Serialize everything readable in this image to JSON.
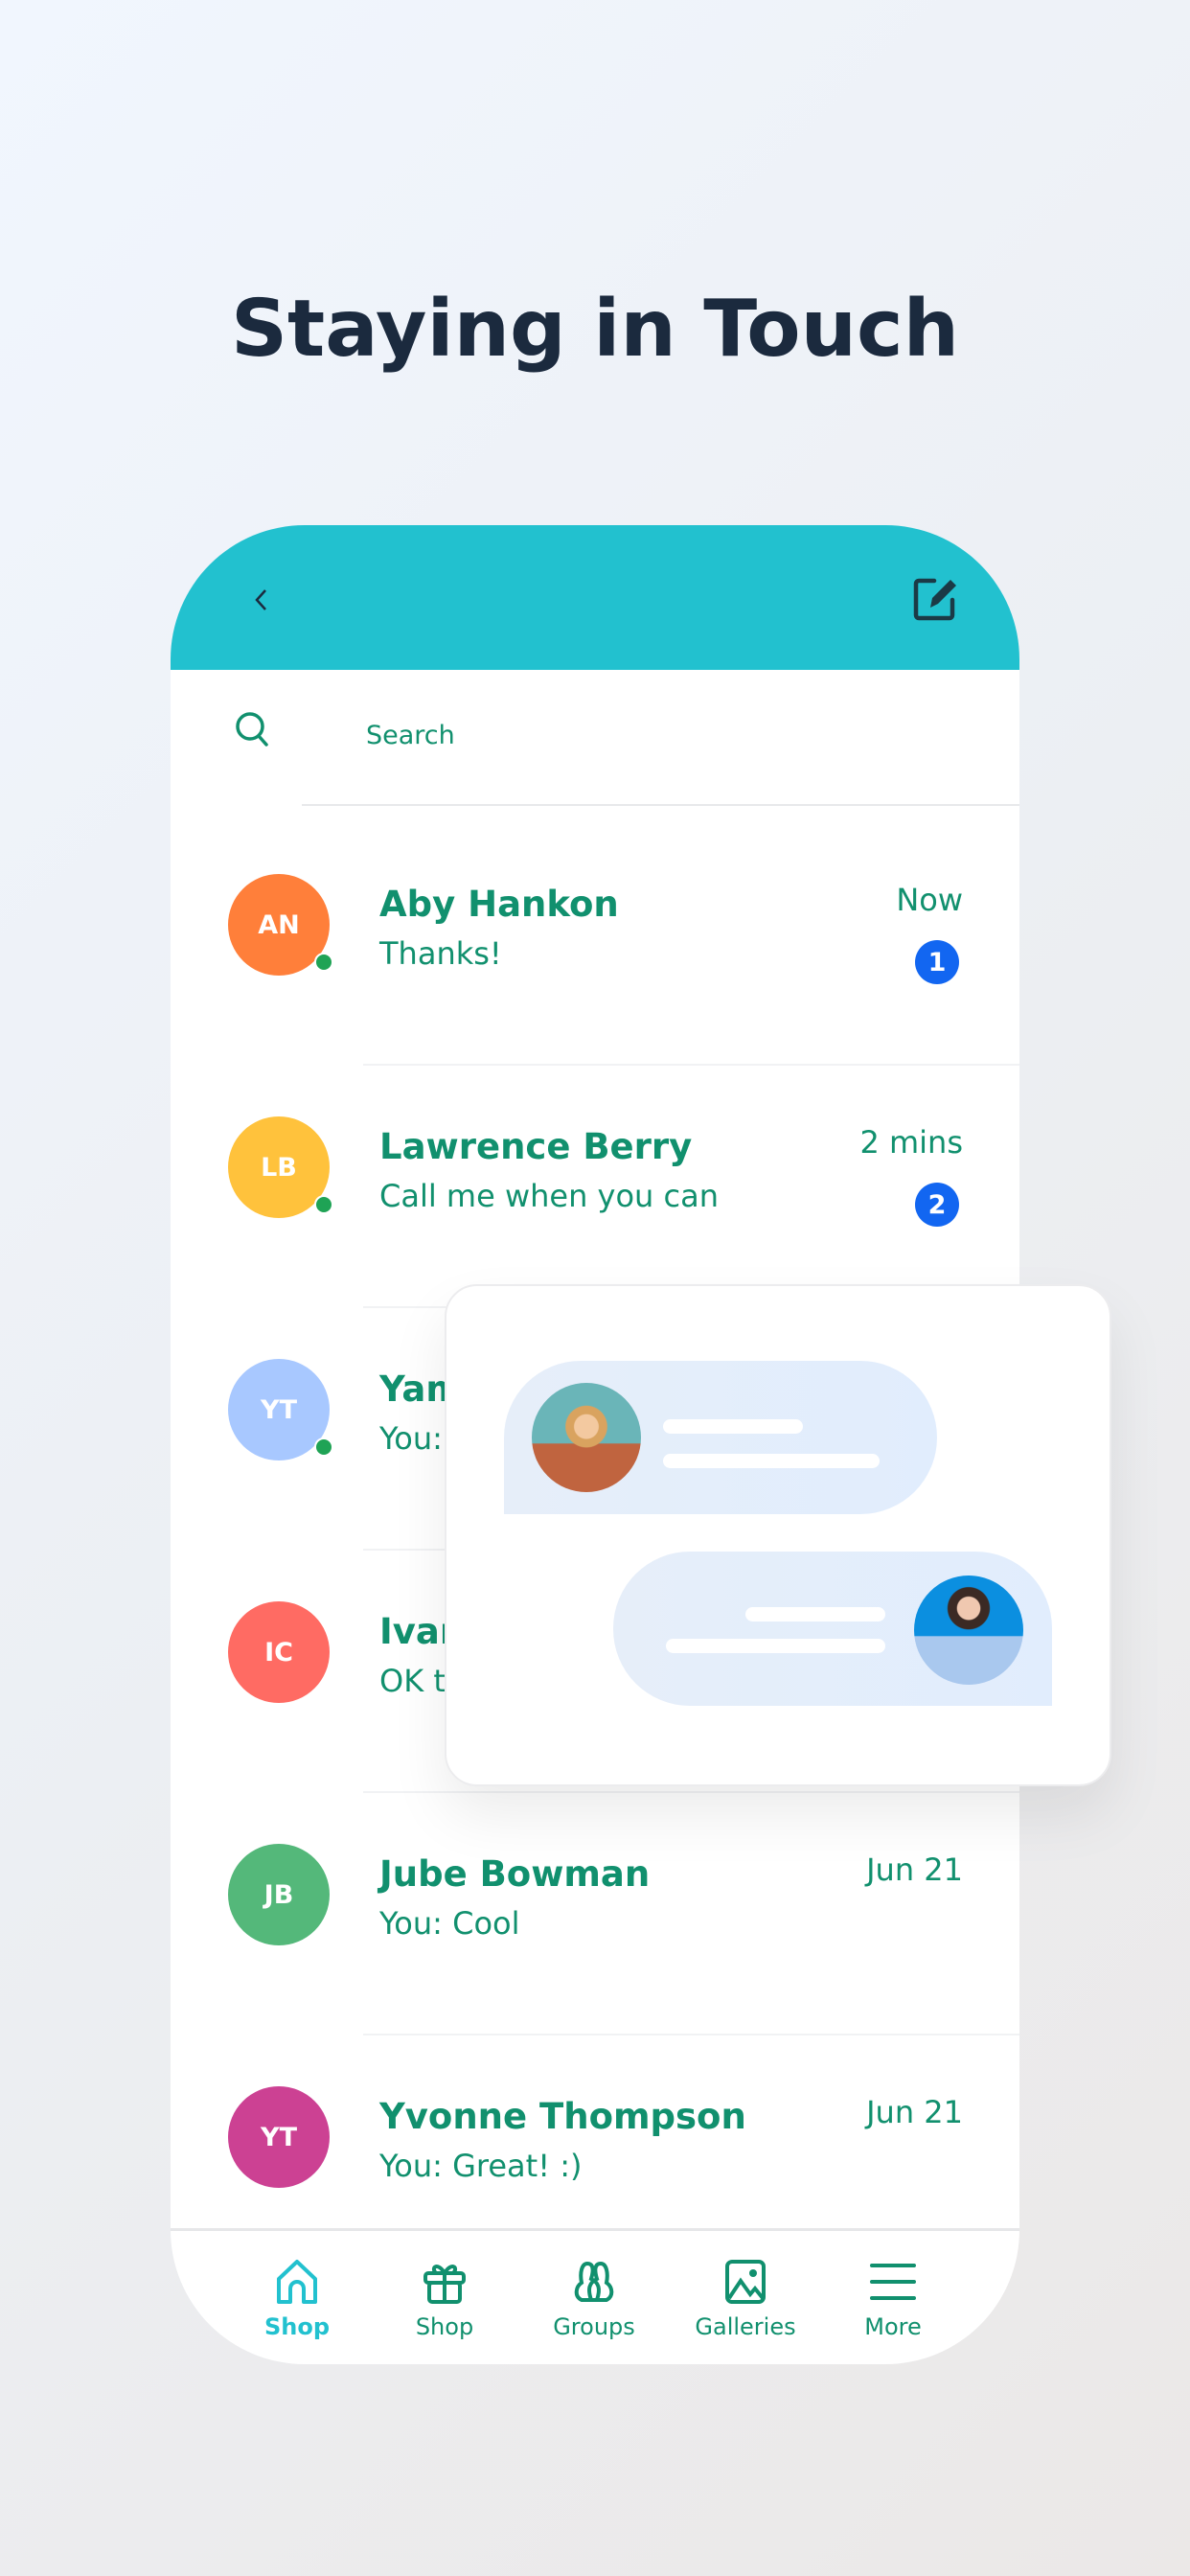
{
  "title": "Staying in Touch",
  "colors": {
    "header": "#22c1cf",
    "accent_text": "#11906e",
    "badge": "#1266f1",
    "online": "#1fa355",
    "title": "#1b2a3e"
  },
  "header": {
    "back_icon": "chevron-left-icon",
    "compose_icon": "edit-icon"
  },
  "search": {
    "placeholder": "Search",
    "icon": "search-icon"
  },
  "conversations": [
    {
      "initials": "AN",
      "name": "Aby Hankon",
      "message": "Thanks!",
      "time": "Now",
      "unread": "1",
      "online": true,
      "color": "#ff7f3a"
    },
    {
      "initials": "LB",
      "name": "Lawrence Berry",
      "message": "Call me when you can",
      "time": "2 mins",
      "unread": "2",
      "online": true,
      "color": "#ffc23c"
    },
    {
      "initials": "YT",
      "name": "Yam",
      "message": "You:",
      "time": "",
      "unread": "",
      "online": true,
      "color": "#a8c8ff"
    },
    {
      "initials": "IC",
      "name": "Ivar",
      "message": "OK t",
      "time": "",
      "unread": "",
      "online": false,
      "color": "#ff6b63"
    },
    {
      "initials": "JB",
      "name": "Jube Bowman",
      "message": "You: Cool",
      "time": "Jun 21",
      "unread": "",
      "online": false,
      "color": "#54b87a"
    },
    {
      "initials": "YT",
      "name": "Yvonne Thompson",
      "message": "You: Great! :)",
      "time": "Jun 21",
      "unread": "",
      "online": false,
      "color": "#cc4193"
    }
  ],
  "nav": [
    {
      "label": "Shop",
      "icon": "home-icon",
      "active": true
    },
    {
      "label": "Shop",
      "icon": "gift-icon",
      "active": false
    },
    {
      "label": "Groups",
      "icon": "groups-icon",
      "active": false
    },
    {
      "label": "Galleries",
      "icon": "image-icon",
      "active": false
    },
    {
      "label": "More",
      "icon": "menu-icon",
      "active": false
    }
  ]
}
